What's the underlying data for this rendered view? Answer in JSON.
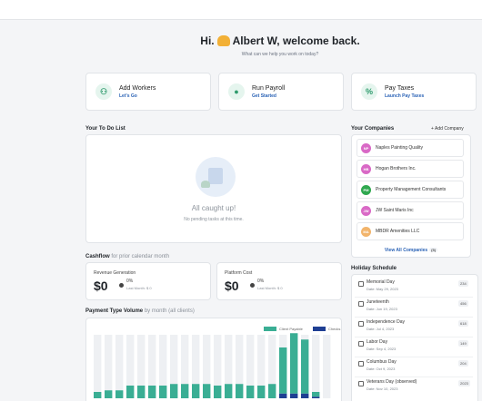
{
  "header": {
    "greeting": "Hi.",
    "user_greeting": "Albert W, welcome back.",
    "subtitle": "What can we help you work on today?"
  },
  "actions": [
    {
      "title": "Add Workers",
      "link": "Let's Go"
    },
    {
      "title": "Run Payroll",
      "link": "Get Started"
    },
    {
      "title": "Pay Taxes",
      "link": "Launch Pay Taxes"
    }
  ],
  "todo": {
    "title": "Your To Do List",
    "empty_title": "All caught up!",
    "empty_sub": "No pending tasks at this time."
  },
  "cashflow": {
    "title": "Cashflow",
    "title_muted": "for prior calendar month",
    "cards": [
      {
        "label": "Revenue Generation",
        "value": "$0",
        "pct": "0%",
        "last": "Last Month: $ 0"
      },
      {
        "label": "Platform Cost",
        "value": "$0",
        "pct": "0%",
        "last": "Last Month: $ 0"
      }
    ]
  },
  "payment_volume": {
    "title": "Payment Type Volume",
    "title_muted": "by month (all clients)"
  },
  "chart_data": {
    "type": "bar",
    "series": [
      {
        "name": "Client Payable",
        "color": "#3aae94",
        "values": [
          4,
          5,
          5,
          8,
          8,
          8,
          8,
          9,
          9,
          9,
          9,
          8,
          9,
          9,
          8,
          8,
          9,
          29,
          38,
          34,
          3
        ]
      },
      {
        "name": "Checks",
        "color": "#1f3f93",
        "values": [
          0,
          0,
          0,
          0,
          0,
          0,
          0,
          0,
          0,
          0,
          0,
          0,
          0,
          0,
          0,
          0,
          0,
          3,
          3,
          3,
          1
        ]
      }
    ],
    "background_bars": 22
  },
  "companies": {
    "title": "Your Companies",
    "add_label": "+  Add Company",
    "items": [
      {
        "initials": "NP",
        "name": "Naples Painting Quality",
        "color": "#d969c6"
      },
      {
        "initials": "HB",
        "name": "Hogan Brothers Inc.",
        "color": "#d969c6"
      },
      {
        "initials": "PM",
        "name": "Property Management Consultants",
        "color": "#2fa84f"
      },
      {
        "initials": "JW",
        "name": "JW Saint Maris Inc",
        "color": "#d969c6"
      },
      {
        "initials": "MA",
        "name": "MBDR Amenities LLC",
        "color": "#f2b46b"
      }
    ],
    "view_all": "View All Companies",
    "view_all_count": "(5)"
  },
  "holidays": {
    "title": "Holiday Schedule",
    "items": [
      {
        "name": "Memorial Day",
        "date": "Date: May 29, 2023",
        "days": "234"
      },
      {
        "name": "Juneteenth",
        "date": "Date: Jun 19, 2023",
        "days": "456"
      },
      {
        "name": "Independence Day",
        "date": "Date: Jul 4, 2023",
        "days": "618"
      },
      {
        "name": "Labor Day",
        "date": "Date: Sep 4, 2023",
        "days": "149"
      },
      {
        "name": "Columbus Day",
        "date": "Date: Oct 9, 2023",
        "days": "204"
      },
      {
        "name": "Veterans Day (observed)",
        "date": "Date: Nov 10, 2023",
        "days": "2023"
      }
    ]
  }
}
